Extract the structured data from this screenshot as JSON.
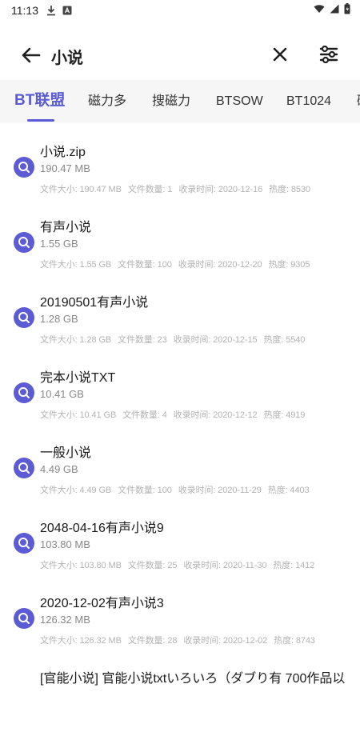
{
  "status": {
    "time": "11:13"
  },
  "search": {
    "query": "小说"
  },
  "tabs": [
    "BT联盟",
    "磁力多",
    "搜磁力",
    "BTSOW",
    "BT1024",
    "磁"
  ],
  "colors": {
    "accent": "#5b5bd6"
  },
  "results": [
    {
      "title": "小说.zip",
      "size": "190.47 MB",
      "meta_size": "文件大小: 190.47 MB",
      "meta_count": "文件数量: 1",
      "meta_date": "收录时间: 2020-12-16",
      "meta_heat": "热度: 8530"
    },
    {
      "title": "有声小说",
      "size": "1.55 GB",
      "meta_size": "文件大小: 1.55 GB",
      "meta_count": "文件数量: 100",
      "meta_date": "收录时间: 2020-12-20",
      "meta_heat": "热度: 9305"
    },
    {
      "title": "20190501有声小说",
      "size": "1.28 GB",
      "meta_size": "文件大小: 1.28 GB",
      "meta_count": "文件数量: 23",
      "meta_date": "收录时间: 2020-12-15",
      "meta_heat": "热度: 5540"
    },
    {
      "title": "完本小说TXT",
      "size": "10.41 GB",
      "meta_size": "文件大小: 10.41 GB",
      "meta_count": "文件数量: 4",
      "meta_date": "收录时间: 2020-12-12",
      "meta_heat": "热度: 4919"
    },
    {
      "title": "一般小说",
      "size": "4.49 GB",
      "meta_size": "文件大小: 4.49 GB",
      "meta_count": "文件数量: 100",
      "meta_date": "收录时间: 2020-11-29",
      "meta_heat": "热度: 4403"
    },
    {
      "title": "2048-04-16有声小说9",
      "size": "103.80 MB",
      "meta_size": "文件大小: 103.80 MB",
      "meta_count": "文件数量: 25",
      "meta_date": "收录时间: 2020-11-30",
      "meta_heat": "热度: 1412"
    },
    {
      "title": "2020-12-02有声小说3",
      "size": "126.32 MB",
      "meta_size": "文件大小: 126.32 MB",
      "meta_count": "文件数量: 28",
      "meta_date": "收录时间: 2020-12-02",
      "meta_heat": "热度: 8743"
    },
    {
      "title": "[官能小说] 官能小说txtいろいろ（ダブり有 700作品以"
    }
  ]
}
